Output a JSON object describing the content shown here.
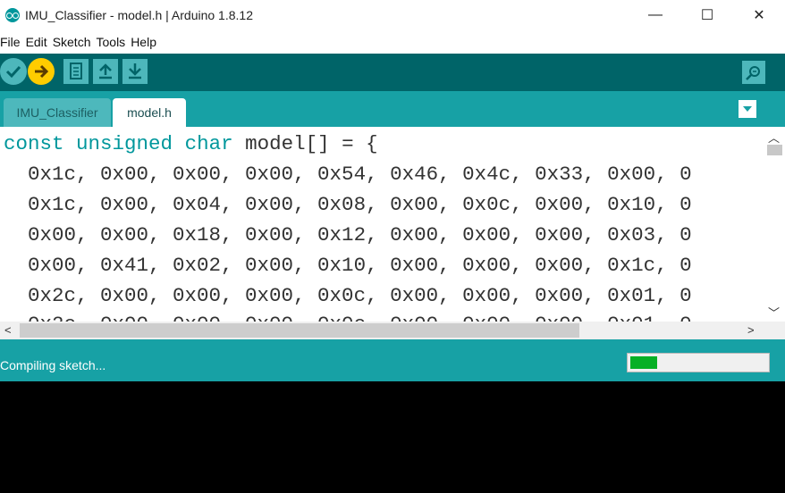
{
  "window": {
    "title": "IMU_Classifier - model.h | Arduino 1.8.12",
    "minimize_glyph": "—",
    "maximize_glyph": "☐",
    "close_glyph": "✕"
  },
  "menu": [
    "File",
    "Edit",
    "Sketch",
    "Tools",
    "Help"
  ],
  "toolbar": {
    "buttons": [
      "verify-icon",
      "upload-icon",
      "new-icon",
      "open-icon",
      "save-icon"
    ],
    "serial_monitor": "serial-monitor-icon",
    "accent": "#ffcc00",
    "bg": "#006468"
  },
  "tabs": [
    {
      "label": "IMU_Classifier",
      "active": false
    },
    {
      "label": "model.h",
      "active": true
    }
  ],
  "editor": {
    "keyword1": "const",
    "keyword2": "unsigned",
    "keyword3": "char",
    "decl_rest": " model[] = {",
    "lines": [
      "  0x1c, 0x00, 0x00, 0x00, 0x54, 0x46, 0x4c, 0x33, 0x00, 0",
      "  0x1c, 0x00, 0x04, 0x00, 0x08, 0x00, 0x0c, 0x00, 0x10, 0",
      "  0x00, 0x00, 0x18, 0x00, 0x12, 0x00, 0x00, 0x00, 0x03, 0",
      "  0x00, 0x41, 0x02, 0x00, 0x10, 0x00, 0x00, 0x00, 0x1c, 0",
      "  0x2c, 0x00, 0x00, 0x00, 0x0c, 0x00, 0x00, 0x00, 0x01, 0"
    ],
    "keyword_color": "#00979c"
  },
  "status": {
    "text": "Compiling sketch...",
    "progress": 0.2,
    "progress_color": "#06b025"
  }
}
